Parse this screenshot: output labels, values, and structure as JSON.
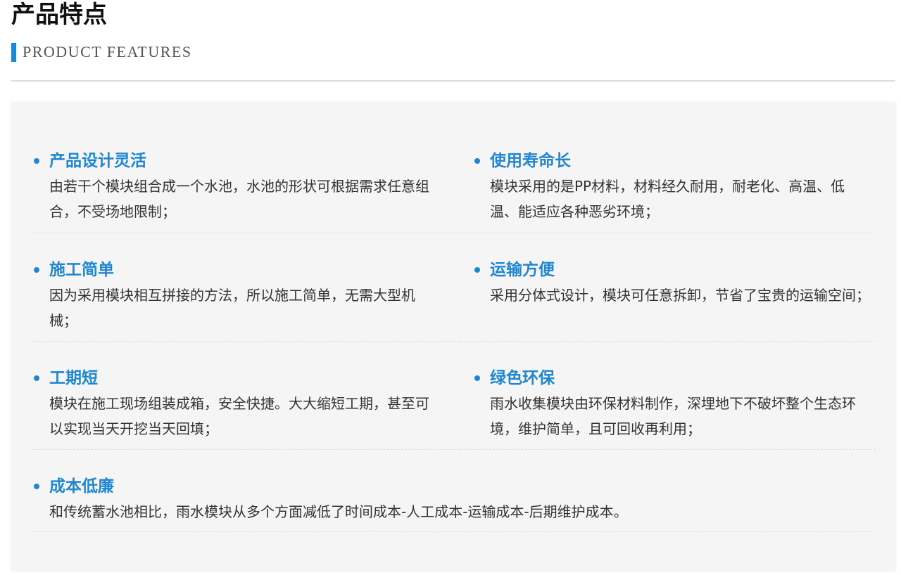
{
  "header": {
    "title_cn": "产品特点",
    "subtitle_en": "PRODUCT FEATURES"
  },
  "colors": {
    "accent": "#1f87cf",
    "panel_bg": "#f5f5f5",
    "text": "#333333"
  },
  "features": [
    {
      "title": "产品设计灵活",
      "desc": "由若干个模块组合成一个水池，水池的形状可根据需求任意组合，不受场地限制；"
    },
    {
      "title": "使用寿命长",
      "desc": "模块采用的是PP材料，材料经久耐用，耐老化、高温、低温、能适应各种恶劣环境；"
    },
    {
      "title": "施工简单",
      "desc": "因为采用模块相互拼接的方法，所以施工简单，无需大型机械；"
    },
    {
      "title": "运输方便",
      "desc": "采用分体式设计，模块可任意拆卸，节省了宝贵的运输空间；"
    },
    {
      "title": "工期短",
      "desc": "模块在施工现场组装成箱，安全快捷。大大缩短工期，甚至可以实现当天开挖当天回填；"
    },
    {
      "title": "绿色环保",
      "desc": "雨水收集模块由环保材料制作，深埋地下不破坏整个生态环境，维护简单，且可回收再利用；"
    },
    {
      "title": "成本低廉",
      "desc": "和传统蓄水池相比，雨水模块从多个方面减低了时间成本-人工成本-运输成本-后期维护成本。"
    }
  ]
}
